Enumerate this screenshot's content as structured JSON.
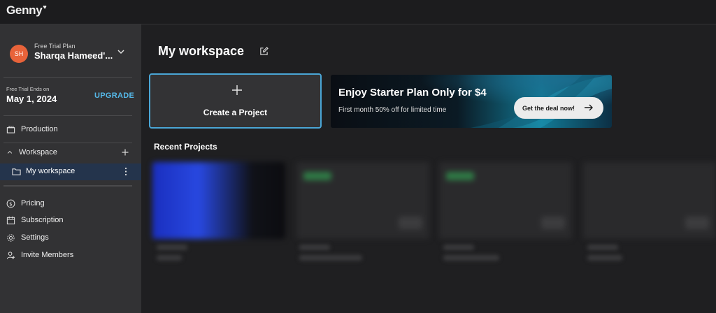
{
  "app": {
    "logo": "Genny"
  },
  "user": {
    "initials": "SH",
    "plan": "Free Trial Plan",
    "name": "Sharqa Hameed'..."
  },
  "trial": {
    "label": "Free Trial Ends on",
    "date": "May 1, 2024",
    "upgrade_label": "UPGRADE"
  },
  "sidebar": {
    "production": "Production",
    "workspace": "Workspace",
    "my_workspace": "My workspace",
    "pricing": "Pricing",
    "subscription": "Subscription",
    "settings": "Settings",
    "invite": "Invite Members"
  },
  "main": {
    "title": "My workspace",
    "create_label": "Create a Project",
    "promo_title": "Enjoy Starter Plan Only for $4",
    "promo_sub": "First month 50% off for limited time",
    "deal_label": "Get the deal now!",
    "recent_title": "Recent Projects"
  },
  "colors": {
    "accent": "#55b8e8",
    "avatar": "#e8633a",
    "active_bg": "#24344c"
  }
}
